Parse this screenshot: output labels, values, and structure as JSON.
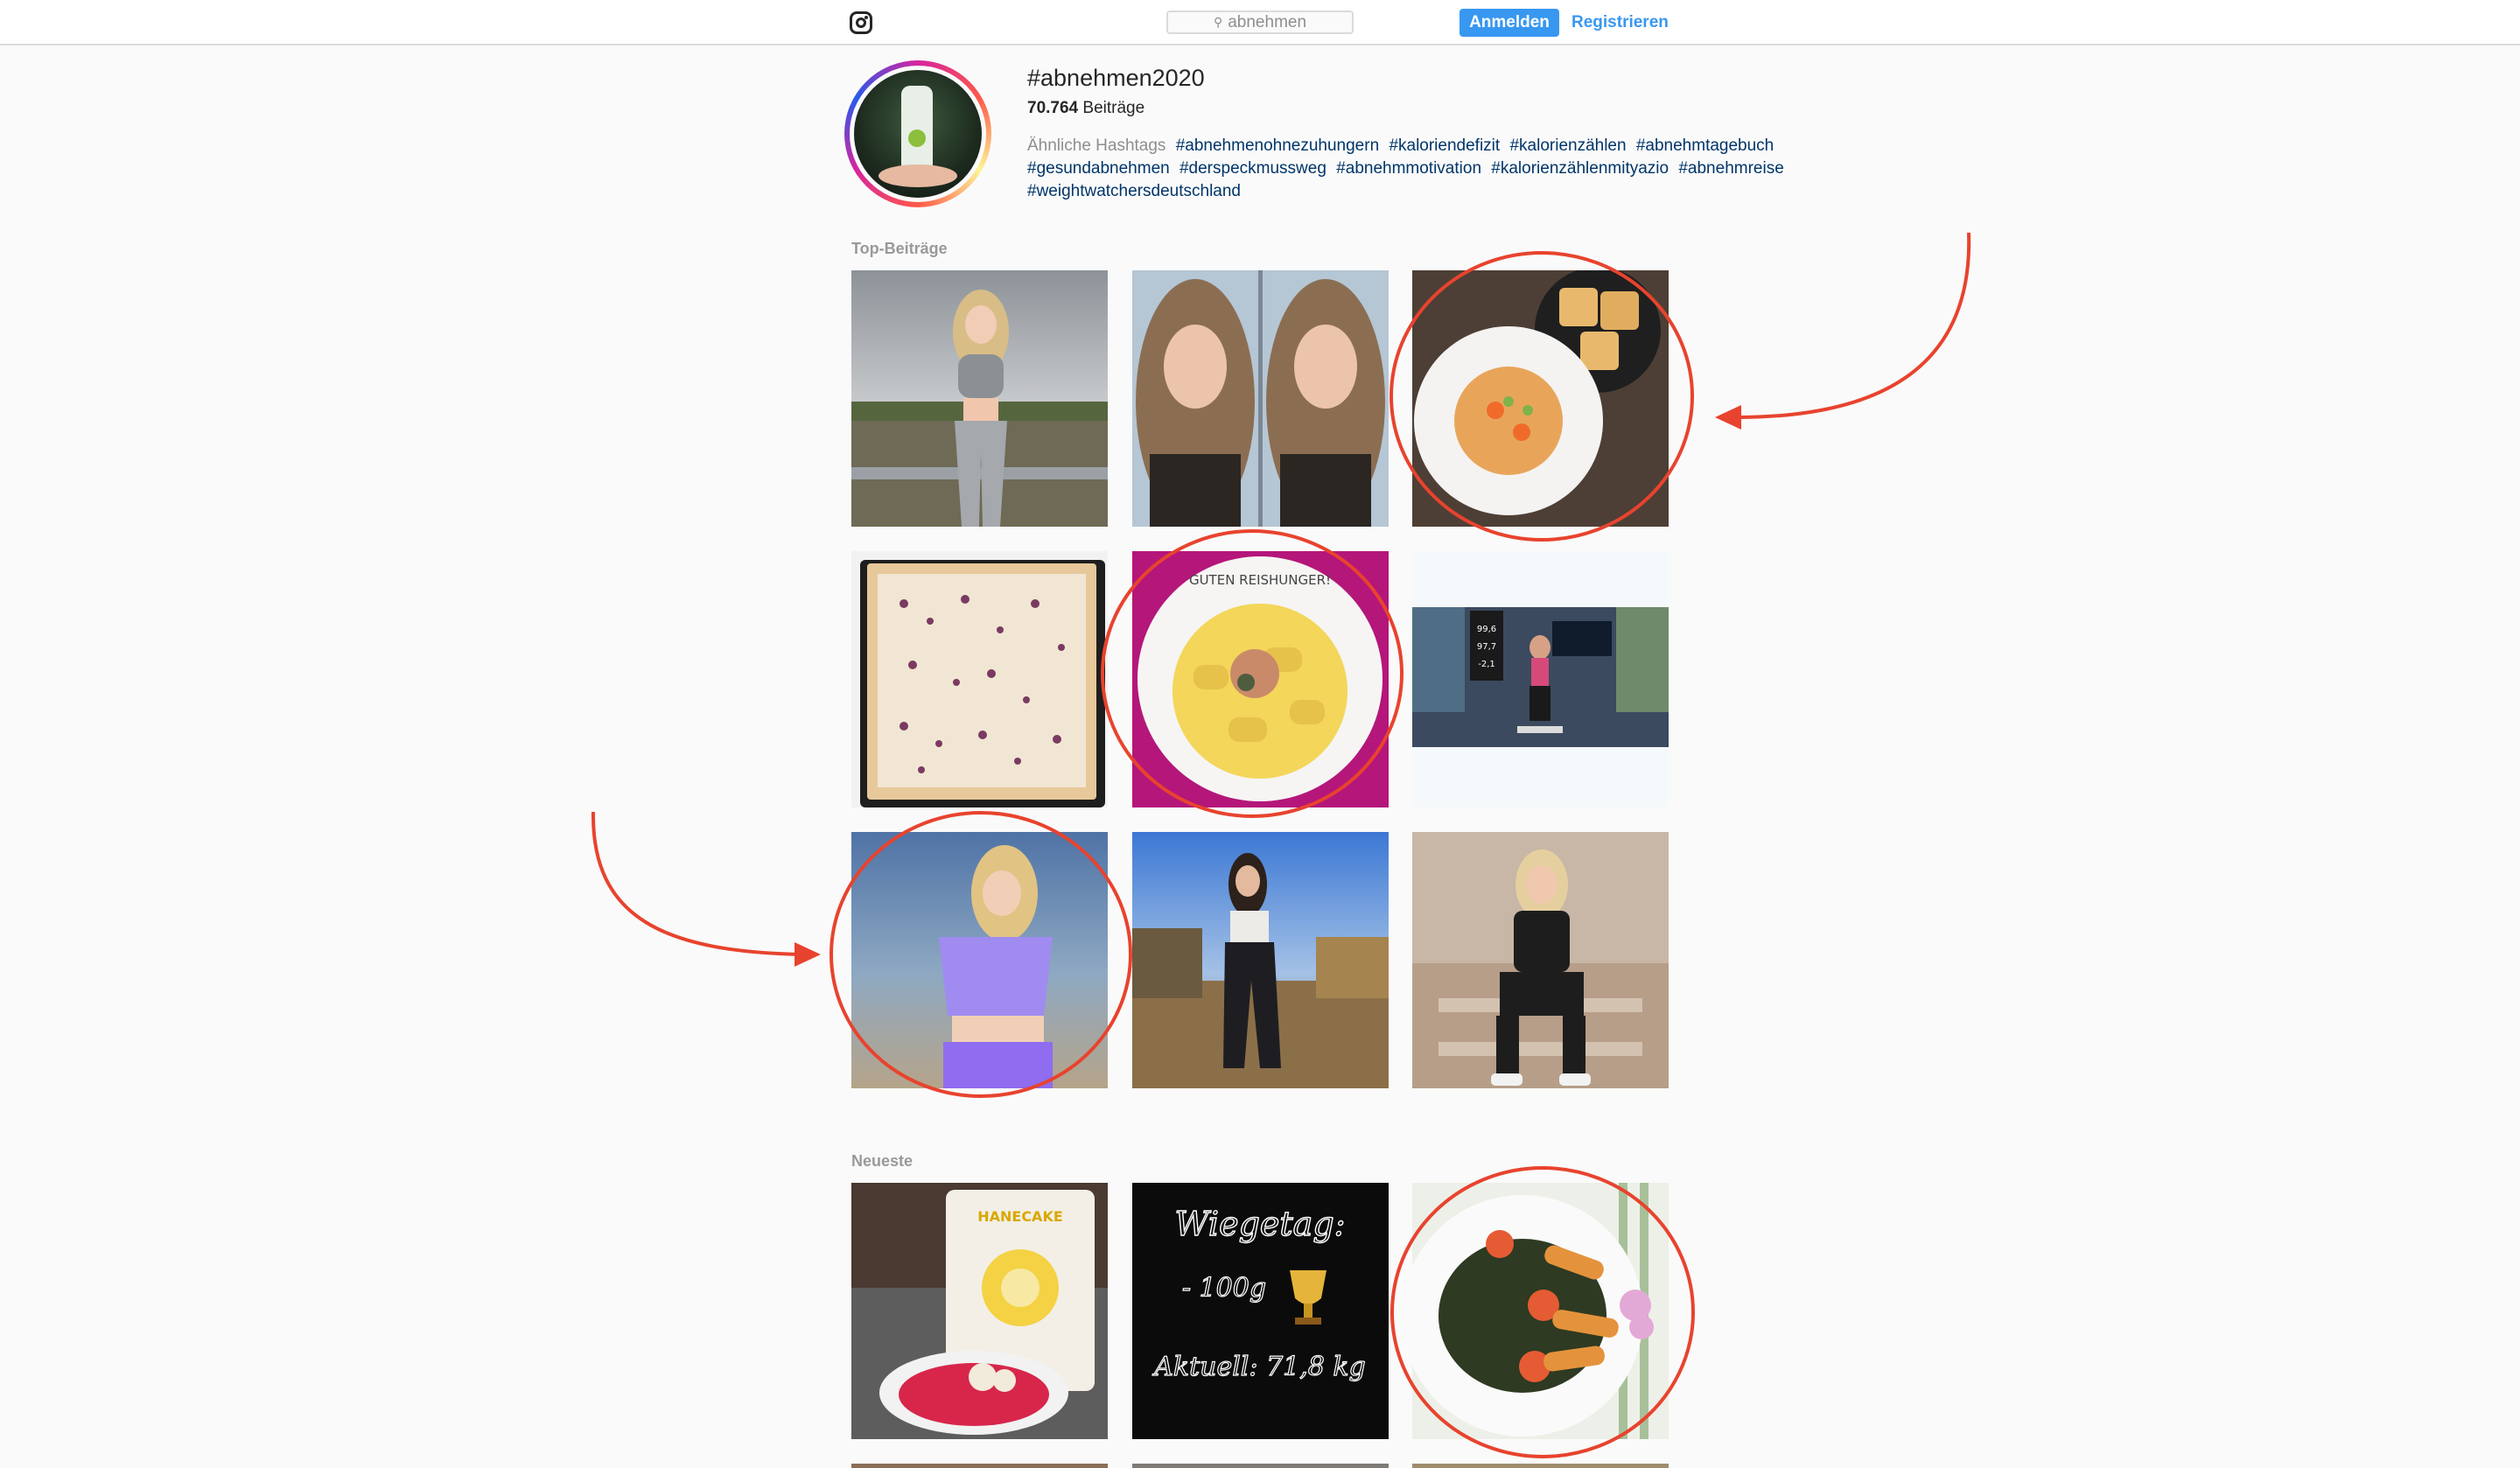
{
  "topbar": {
    "logo_icon": "instagram-icon",
    "search_value": "abnehmen",
    "login_label": "Anmelden",
    "register_label": "Registrieren"
  },
  "hashtag": {
    "title": "#abnehmen2020",
    "post_count": "70.764",
    "post_label": "Beiträge",
    "related_label": "Ähnliche Hashtags",
    "related": [
      "#abnehmenohnezuhungern",
      "#kaloriendefizit",
      "#kalorienzählen",
      "#abnehmtagebuch",
      "#gesundabnehmen",
      "#derspeckmussweg",
      "#abnehmmotivation",
      "#kalorienzählenmityazio",
      "#abnehmreise",
      "#weightwatchersdeutschland"
    ]
  },
  "sections": {
    "top_label": "Top-Beiträge",
    "recent_label": "Neueste"
  },
  "tiles": {
    "scale_numbers": [
      "99,6",
      "97,7",
      "-2,1"
    ],
    "plate_text": "GUTEN REISHUNGER!",
    "product_text": "HANECAKE",
    "wiegetag_title": "Wiegetag:",
    "wiegetag_change": "- 100g",
    "wiegetag_current": "Aktuell: 71,8 kg",
    "trophy_icon": "trophy-icon"
  },
  "annotation_color": "#e8432e"
}
